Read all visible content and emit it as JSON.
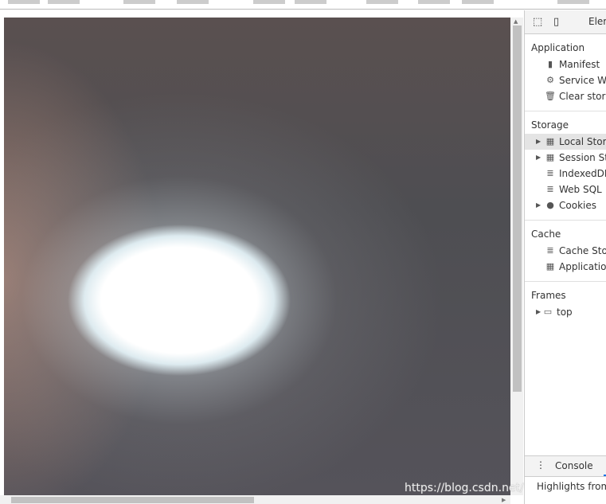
{
  "devtools": {
    "tab_elements": "Elem",
    "application": {
      "title": "Application",
      "items": [
        {
          "label": "Manifest",
          "icon": "file-icon"
        },
        {
          "label": "Service Wo",
          "icon": "gear-icon"
        },
        {
          "label": "Clear storag",
          "icon": "trash-icon"
        }
      ]
    },
    "storage": {
      "title": "Storage",
      "items": [
        {
          "label": "Local Stora",
          "icon": "grid-icon",
          "expandable": true,
          "selected": true
        },
        {
          "label": "Session Sto",
          "icon": "grid-icon",
          "expandable": true
        },
        {
          "label": "IndexedDB",
          "icon": "database-icon"
        },
        {
          "label": "Web SQL",
          "icon": "database-icon"
        },
        {
          "label": "Cookies",
          "icon": "cookie-icon",
          "expandable": true
        }
      ]
    },
    "cache": {
      "title": "Cache",
      "items": [
        {
          "label": "Cache Stora",
          "icon": "database-icon"
        },
        {
          "label": "Application",
          "icon": "grid-icon"
        }
      ]
    },
    "frames": {
      "title": "Frames",
      "items": [
        {
          "label": "top",
          "icon": "frame-icon",
          "expandable": true
        }
      ]
    },
    "drawer": {
      "console_tab": "Console",
      "highlights_text": "Highlights from"
    }
  },
  "watermark": "https://blog.csdn.net/qq_"
}
